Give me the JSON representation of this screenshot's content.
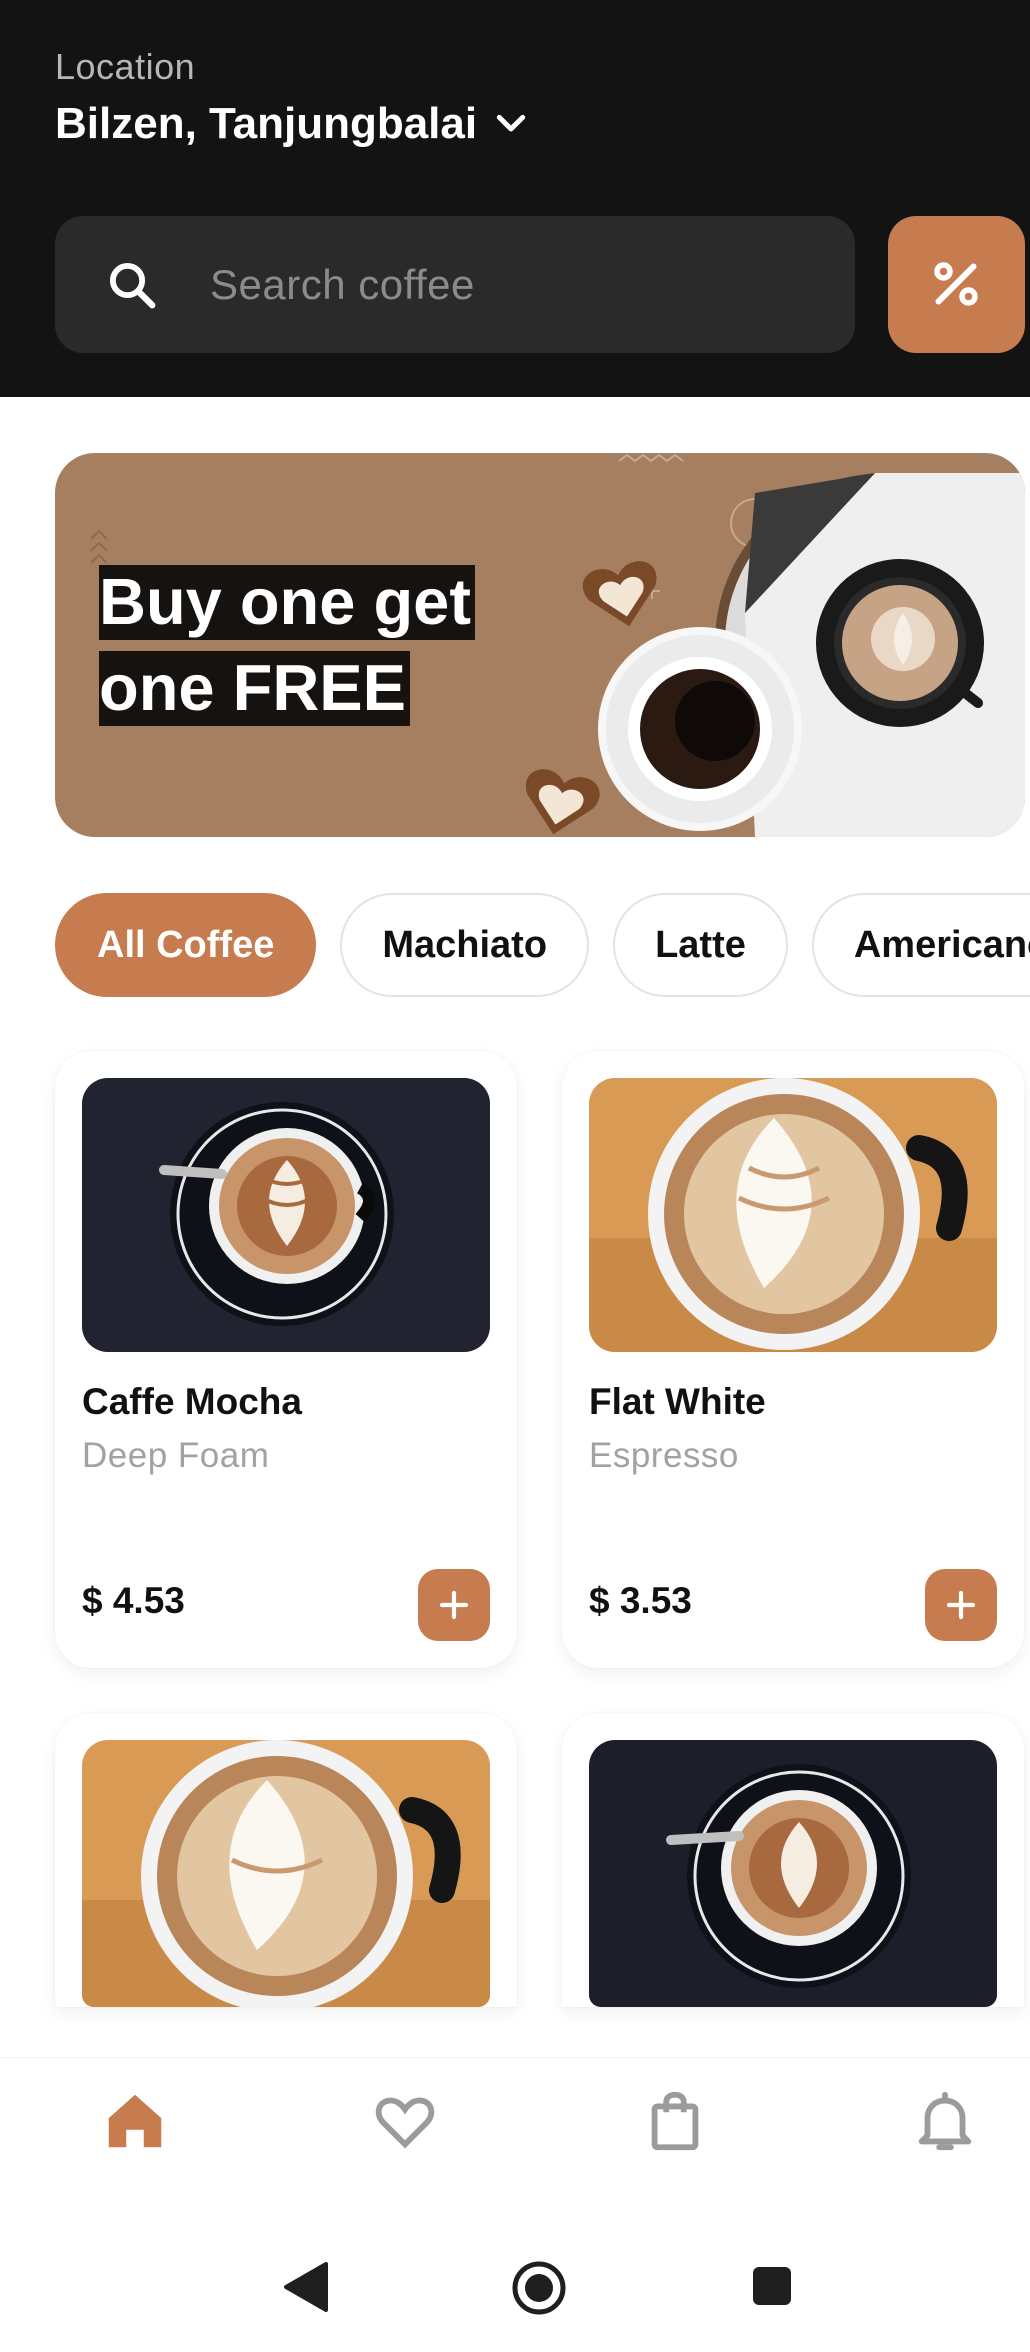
{
  "location": {
    "label": "Location",
    "value": "Bilzen, Tanjungbalai"
  },
  "search": {
    "placeholder": "Search coffee"
  },
  "promo": {
    "line1": "Buy one get",
    "line2": "one FREE"
  },
  "categories": [
    {
      "label": "All Coffee",
      "active": true
    },
    {
      "label": "Machiato",
      "active": false
    },
    {
      "label": "Latte",
      "active": false
    },
    {
      "label": "Americano",
      "active": false
    }
  ],
  "products": [
    {
      "name": "Caffe Mocha",
      "subtitle": "Deep Foam",
      "price": "$ 4.53",
      "image": "dark-cup"
    },
    {
      "name": "Flat White",
      "subtitle": "Espresso",
      "price": "$ 3.53",
      "image": "light-cup"
    },
    {
      "name": "",
      "subtitle": "",
      "price": "",
      "image": "light-cup"
    },
    {
      "name": "",
      "subtitle": "",
      "price": "",
      "image": "dark-cup"
    }
  ],
  "nav": {
    "items": [
      "home-icon",
      "heart-icon",
      "bag-icon",
      "bell-icon"
    ],
    "active": "home-icon"
  },
  "colors": {
    "accent": "#c67c4e",
    "header_bg": "#131313",
    "promo_bg": "#a57f60"
  }
}
